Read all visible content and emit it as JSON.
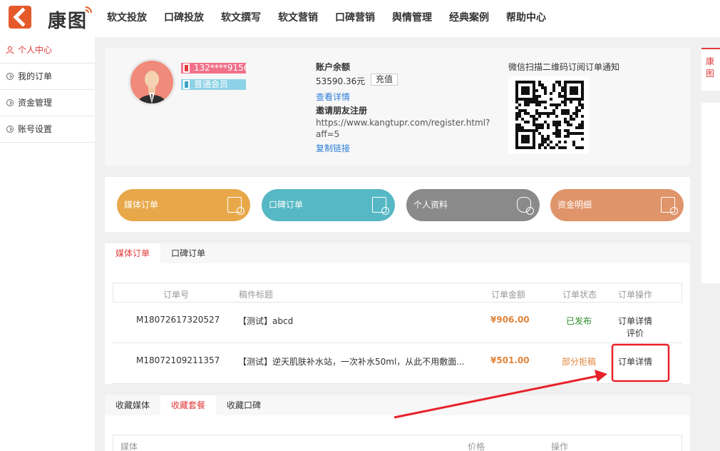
{
  "brand": {
    "logo_text": "康图"
  },
  "nav": [
    {
      "label": "软文投放"
    },
    {
      "label": "口碑投放"
    },
    {
      "label": "软文撰写"
    },
    {
      "label": "软文营销"
    },
    {
      "label": "口碑营销"
    },
    {
      "label": "舆情管理"
    },
    {
      "label": "经典案例"
    },
    {
      "label": "帮助中心"
    }
  ],
  "sidebar": {
    "items": [
      {
        "label": "个人中心",
        "icon": "user-icon",
        "active": true
      },
      {
        "label": "我的订单",
        "icon": "chevron-circle-icon"
      },
      {
        "label": "资金管理",
        "icon": "chevron-circle-icon"
      },
      {
        "label": "账号设置",
        "icon": "chevron-circle-icon"
      }
    ]
  },
  "profile": {
    "phone": "132****9156",
    "member_level": "普通会员",
    "balance_label": "账户余额",
    "balance": "53590.36元",
    "recharge_label": "充值",
    "view_detail_label": "查看详情",
    "invite_title": "邀请朋友注册",
    "invite_url": "https://www.kangtupr.com/register.html?aff=5",
    "copy_link_label": "复制链接",
    "qr_title": "微信扫描二维码订阅订单通知"
  },
  "cards": [
    {
      "label": "媒体订单",
      "color": "#e8a84a"
    },
    {
      "label": "口碑订单",
      "color": "#56b8c4"
    },
    {
      "label": "个人资料",
      "color": "#8a8a8a"
    },
    {
      "label": "资金明细",
      "color": "#e0946a"
    }
  ],
  "orders": {
    "tabs": [
      {
        "label": "媒体订单",
        "active": true
      },
      {
        "label": "口碑订单"
      }
    ],
    "columns": [
      "订单号",
      "稿件标题",
      "订单金额",
      "订单状态",
      "订单操作"
    ],
    "rows": [
      {
        "id": "M18072617320527",
        "title": "【测试】abcd",
        "amount": "¥906.00",
        "status": "已发布",
        "status_color": "#2e8b2e",
        "actions": [
          "订单详情",
          "评价"
        ]
      },
      {
        "id": "M18072109211357",
        "title": "【测试】逆天肌肤补水站，一次补水50ml，从此不用敷面...",
        "amount": "¥501.00",
        "status": "部分拒稿",
        "status_color": "#e0843a",
        "actions": [
          "订单详情"
        ]
      }
    ]
  },
  "favorites": {
    "tabs": [
      {
        "label": "收藏媒体"
      },
      {
        "label": "收藏套餐",
        "active": true
      },
      {
        "label": "收藏口碑"
      }
    ],
    "columns": [
      "媒体",
      "价格",
      "操作"
    ]
  },
  "right_rail": {
    "tab_label": "康图"
  },
  "colors": {
    "accent": "#e03a3a",
    "link": "#2f7ed8",
    "amount": "#e0843a"
  }
}
